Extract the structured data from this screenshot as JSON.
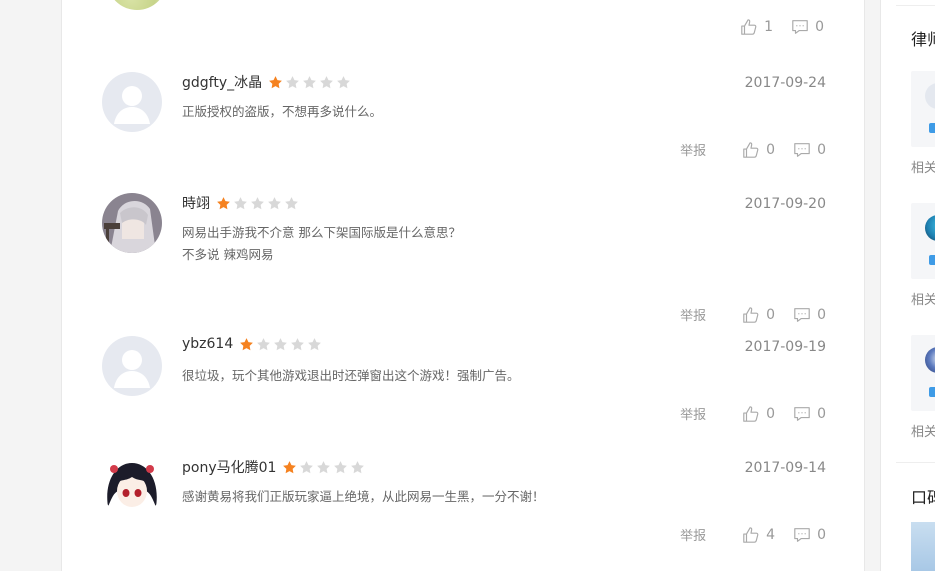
{
  "colors": {
    "star_on": "#f58220",
    "star_off": "#d8d8d8",
    "badge": "#3e9be6"
  },
  "top_actions": {
    "likes": "1",
    "comments": "0"
  },
  "report_label": "举报",
  "reviews": [
    {
      "username": "gdgfty_冰晶",
      "rating": 1,
      "date": "2017-09-24",
      "lines": [
        "正版授权的盗版，不想再多说什么。"
      ],
      "likes": "0",
      "comments": "0",
      "avatar": "default"
    },
    {
      "username": "時翊",
      "rating": 1,
      "date": "2017-09-20",
      "lines": [
        "网易出手游我不介意 那么下架国际版是什么意思？",
        "不多说 辣鸡网易"
      ],
      "likes": "0",
      "comments": "0",
      "avatar": "anime-silver-hair"
    },
    {
      "username": "ybz614",
      "rating": 1,
      "date": "2017-09-19",
      "lines": [
        "很垃圾，玩个其他游戏退出时还弹窗出这个游戏！强制广告。"
      ],
      "likes": "0",
      "comments": "0",
      "avatar": "default"
    },
    {
      "username": "pony马化腾01",
      "rating": 1,
      "date": "2017-09-14",
      "lines": [
        "感谢黄易将我们正版玩家逼上绝境，从此网易一生黑，一分不谢！"
      ],
      "likes": "4",
      "comments": "0",
      "avatar": "anime-black-hair"
    }
  ],
  "sidebar": {
    "title1": "律师",
    "related_label": "相关",
    "title2": "口碑"
  }
}
